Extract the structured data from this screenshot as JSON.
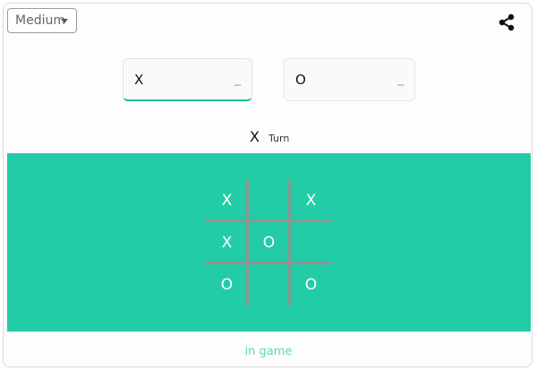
{
  "header": {
    "difficulty_value": "Medium"
  },
  "players": [
    {
      "symbol": "X",
      "score": "_"
    },
    {
      "symbol": "O",
      "score": "_"
    }
  ],
  "turn": {
    "symbol": "X",
    "label": "Turn"
  },
  "board": [
    [
      "X",
      "",
      "X"
    ],
    [
      "X",
      "O",
      ""
    ],
    [
      "O",
      "",
      "O"
    ]
  ],
  "status": "in game",
  "colors": {
    "board_background": "#22cca6",
    "grid_lines": "#8e9594",
    "active_underline": "#1abc9c",
    "status_text": "#5fd6bc"
  },
  "icons": {
    "difficulty_caret": "caret-down-icon",
    "share": "share-icon"
  }
}
